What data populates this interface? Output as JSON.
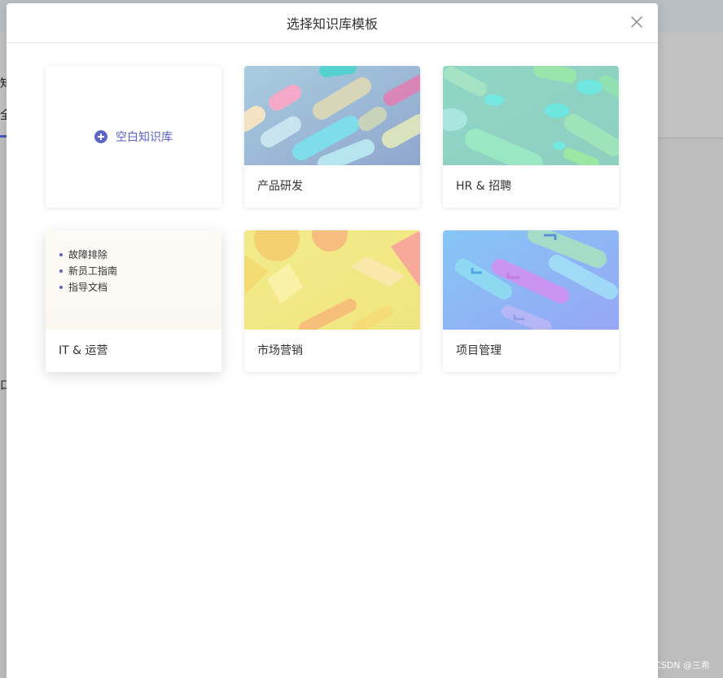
{
  "dialog": {
    "title": "选择知识库模板",
    "close_icon": "close-icon"
  },
  "background": {
    "frag_1": "知",
    "frag_2": "全",
    "frag_3": "口"
  },
  "blank_card": {
    "label": "空白知识库",
    "icon": "plus-circle-icon"
  },
  "templates": [
    {
      "label": "产品研发"
    },
    {
      "label": "HR & 招聘"
    },
    {
      "label": "IT & 运营",
      "preview_items": [
        "故障排除",
        "新员工指南",
        "指导文档"
      ]
    },
    {
      "label": "市场营销"
    },
    {
      "label": "项目管理"
    }
  ],
  "watermark": "CSDN @三希",
  "colors": {
    "accent": "#5b64c8",
    "overlay": "#bdbdbd"
  }
}
